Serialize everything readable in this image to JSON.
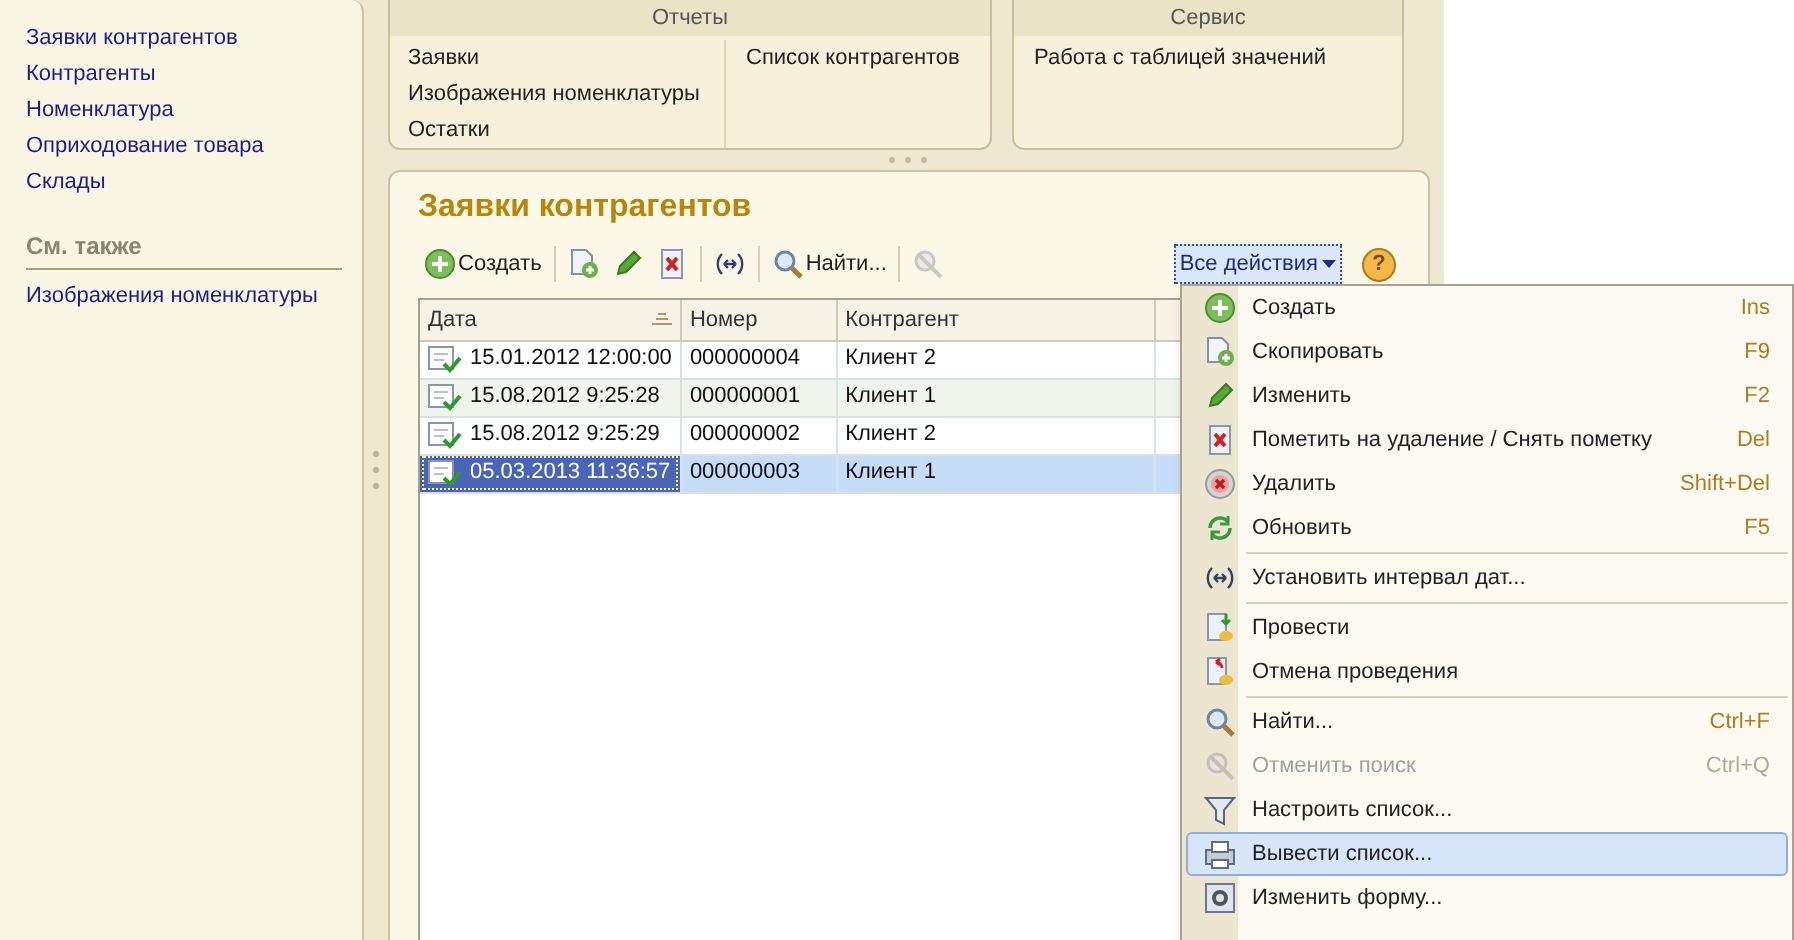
{
  "sidebar": {
    "items": [
      "Заявки контрагентов",
      "Контрагенты",
      "Номенклатура",
      "Оприходование товара",
      "Склады"
    ],
    "see_also": {
      "title": "См. также",
      "items": [
        "Изображения номенклатуры"
      ]
    }
  },
  "reports_panel": {
    "title": "Отчеты",
    "columns": [
      [
        "Заявки",
        "Изображения номенклатуры",
        "Остатки"
      ],
      [
        "Список контрагентов"
      ]
    ]
  },
  "service_panel": {
    "title": "Сервис",
    "items": [
      "Работа с таблицей значений"
    ]
  },
  "form": {
    "title": "Заявки контрагентов",
    "toolbar": [
      {
        "kind": "create",
        "label": "Создать",
        "disabled": false
      },
      {
        "kind": "copy",
        "disabled": false
      },
      {
        "kind": "edit",
        "disabled": false
      },
      {
        "kind": "mark",
        "disabled": false
      },
      {
        "kind": "interval",
        "disabled": false
      },
      {
        "kind": "find",
        "label": "Найти...",
        "disabled": false
      },
      {
        "kind": "cancel",
        "disabled": true
      }
    ],
    "all_actions": {
      "label": "Все действия",
      "expanded": true
    },
    "help": {
      "label": "?"
    },
    "table": {
      "columns": [
        {
          "label": "Дата",
          "sorted": true
        },
        {
          "label": "Номер",
          "sorted": false
        },
        {
          "label": "Контрагент",
          "sorted": false
        }
      ],
      "rows": [
        {
          "cells": [
            "15.01.2012 12:00:00",
            "000000004",
            "Клиент 2"
          ],
          "selected": false
        },
        {
          "cells": [
            "15.08.2012 9:25:28",
            "000000001",
            "Клиент 1"
          ],
          "selected": false
        },
        {
          "cells": [
            "15.08.2012 9:25:29",
            "000000002",
            "Клиент 2"
          ],
          "selected": false
        },
        {
          "cells": [
            "05.03.2013 11:36:57",
            "000000003",
            "Клиент 1"
          ],
          "selected": true
        }
      ]
    }
  },
  "menu": {
    "items": [
      {
        "kind": "item",
        "label": "Создать",
        "shortcut": "Ins",
        "disabled": false,
        "selected": false
      },
      {
        "kind": "item",
        "label": "Скопировать",
        "shortcut": "F9",
        "disabled": false,
        "selected": false
      },
      {
        "kind": "item",
        "label": "Изменить",
        "shortcut": "F2",
        "disabled": false,
        "selected": false
      },
      {
        "kind": "item",
        "label": "Пометить на удаление / Снять пометку",
        "shortcut": "Del",
        "disabled": false,
        "selected": false
      },
      {
        "kind": "item",
        "label": "Удалить",
        "shortcut": "Shift+Del",
        "disabled": false,
        "selected": false
      },
      {
        "kind": "item",
        "label": "Обновить",
        "shortcut": "F5",
        "disabled": false,
        "selected": false
      },
      {
        "kind": "separator"
      },
      {
        "kind": "item",
        "label": "Установить интервал дат...",
        "disabled": false,
        "selected": false
      },
      {
        "kind": "separator"
      },
      {
        "kind": "item",
        "label": "Провести",
        "disabled": false,
        "selected": false
      },
      {
        "kind": "item",
        "label": "Отмена проведения",
        "disabled": false,
        "selected": false
      },
      {
        "kind": "separator"
      },
      {
        "kind": "item",
        "label": "Найти...",
        "shortcut": "Ctrl+F",
        "disabled": false,
        "selected": false
      },
      {
        "kind": "item",
        "label": "Отменить поиск",
        "shortcut": "Ctrl+Q",
        "disabled": true,
        "selected": false
      },
      {
        "kind": "item",
        "label": "Настроить список...",
        "disabled": false,
        "selected": false
      },
      {
        "kind": "item",
        "label": "Вывести список...",
        "disabled": false,
        "selected": true
      },
      {
        "kind": "item",
        "label": "Изменить форму...",
        "disabled": false,
        "selected": false
      }
    ]
  }
}
